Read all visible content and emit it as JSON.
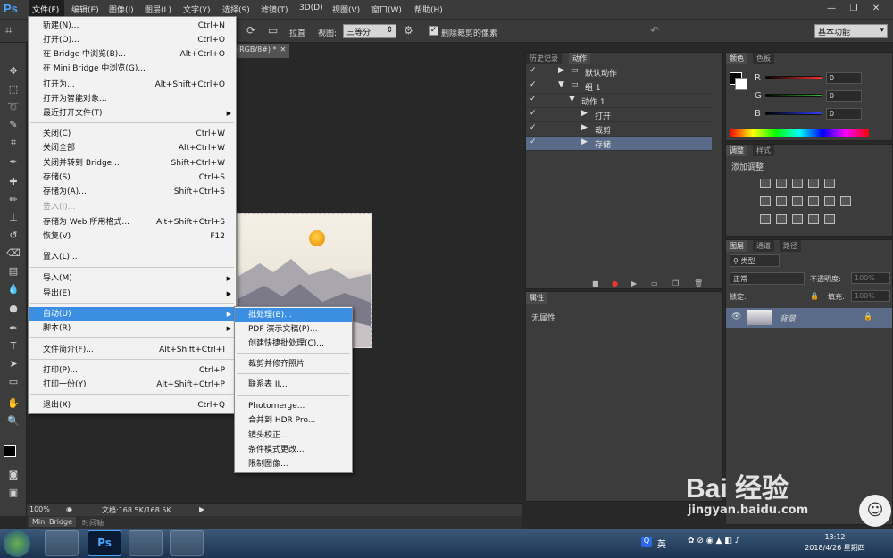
{
  "app": {
    "logo": "Ps"
  },
  "menubar": {
    "items": [
      "文件(F)",
      "编辑(E)",
      "图像(I)",
      "图层(L)",
      "文字(Y)",
      "选择(S)",
      "滤镜(T)",
      "3D(D)",
      "视图(V)",
      "窗口(W)",
      "帮助(H)"
    ]
  },
  "window_controls": {
    "minimize": "—",
    "restore": "❐",
    "close": "✕"
  },
  "options": {
    "straighten": "拉直",
    "view_label": "视图:",
    "view_value": "三等分",
    "delete_cropped": "删除裁剪的像素",
    "workspace": "基本功能"
  },
  "doc_tab": {
    "label": "(RGB/8#) *"
  },
  "status": {
    "zoom": "100%",
    "doc": "文档:168.5K/168.5K"
  },
  "bottom_tabs": {
    "mini_bridge": "Mini Bridge",
    "timeline": "时间轴"
  },
  "actions_panel": {
    "tabs": [
      "历史记录",
      "动作"
    ],
    "rows": [
      {
        "label": "默认动作"
      },
      {
        "label": "组 1"
      },
      {
        "label": "动作 1"
      },
      {
        "label": "打开"
      },
      {
        "label": "裁剪"
      },
      {
        "label": "存储"
      }
    ]
  },
  "properties_panel": {
    "tab": "属性",
    "content": "无属性"
  },
  "color_panel": {
    "tabs": [
      "颜色",
      "色板"
    ],
    "channels": [
      {
        "label": "R",
        "value": "0",
        "color": "#ff3030"
      },
      {
        "label": "G",
        "value": "0",
        "color": "#30c030"
      },
      {
        "label": "B",
        "value": "0",
        "color": "#3040ff"
      }
    ]
  },
  "adjustments_panel": {
    "tabs": [
      "调整",
      "样式"
    ],
    "title": "添加调整"
  },
  "layers_panel": {
    "tabs": [
      "图层",
      "通道",
      "路径"
    ],
    "kind": "类型",
    "blend_mode": "正常",
    "opacity_label": "不透明度:",
    "opacity_value": "100%",
    "lock_label": "锁定:",
    "fill_label": "填充:",
    "fill_value": "100%",
    "layer_name": "背景"
  },
  "file_menu": {
    "items": [
      {
        "label": "新建(N)...",
        "shortcut": "Ctrl+N"
      },
      {
        "label": "打开(O)...",
        "shortcut": "Ctrl+O"
      },
      {
        "label": "在 Bridge 中浏览(B)...",
        "shortcut": "Alt+Ctrl+O"
      },
      {
        "label": "在 Mini Bridge 中浏览(G)...",
        "shortcut": ""
      },
      {
        "label": "打开为...",
        "shortcut": "Alt+Shift+Ctrl+O"
      },
      {
        "label": "打开为智能对象...",
        "shortcut": ""
      },
      {
        "label": "最近打开文件(T)",
        "shortcut": ""
      },
      {
        "label": "关闭(C)",
        "shortcut": "Ctrl+W"
      },
      {
        "label": "关闭全部",
        "shortcut": "Alt+Ctrl+W"
      },
      {
        "label": "关闭并转到 Bridge...",
        "shortcut": "Shift+Ctrl+W"
      },
      {
        "label": "存储(S)",
        "shortcut": "Ctrl+S"
      },
      {
        "label": "存储为(A)...",
        "shortcut": "Shift+Ctrl+S"
      },
      {
        "label": "签入(I)...",
        "shortcut": ""
      },
      {
        "label": "存储为 Web 所用格式...",
        "shortcut": "Alt+Shift+Ctrl+S"
      },
      {
        "label": "恢复(V)",
        "shortcut": "F12"
      },
      {
        "label": "置入(L)...",
        "shortcut": ""
      },
      {
        "label": "导入(M)",
        "shortcut": ""
      },
      {
        "label": "导出(E)",
        "shortcut": ""
      },
      {
        "label": "自动(U)",
        "shortcut": ""
      },
      {
        "label": "脚本(R)",
        "shortcut": ""
      },
      {
        "label": "文件简介(F)...",
        "shortcut": "Alt+Shift+Ctrl+I"
      },
      {
        "label": "打印(P)...",
        "shortcut": "Ctrl+P"
      },
      {
        "label": "打印一份(Y)",
        "shortcut": "Alt+Shift+Ctrl+P"
      },
      {
        "label": "退出(X)",
        "shortcut": "Ctrl+Q"
      }
    ]
  },
  "automate_menu": {
    "items": [
      "批处理(B)...",
      "PDF 演示文稿(P)...",
      "创建快捷批处理(C)...",
      "裁剪并修齐照片",
      "联系表 II...",
      "Photomerge...",
      "合并到 HDR Pro...",
      "镜头校正...",
      "条件模式更改...",
      "限制图像..."
    ]
  },
  "taskbar": {
    "ime": "英",
    "time": "13:12",
    "date": "2018/4/26 星期四"
  },
  "watermark": {
    "brand": "Bai 经验",
    "url": "jingyan.baidu.com"
  }
}
